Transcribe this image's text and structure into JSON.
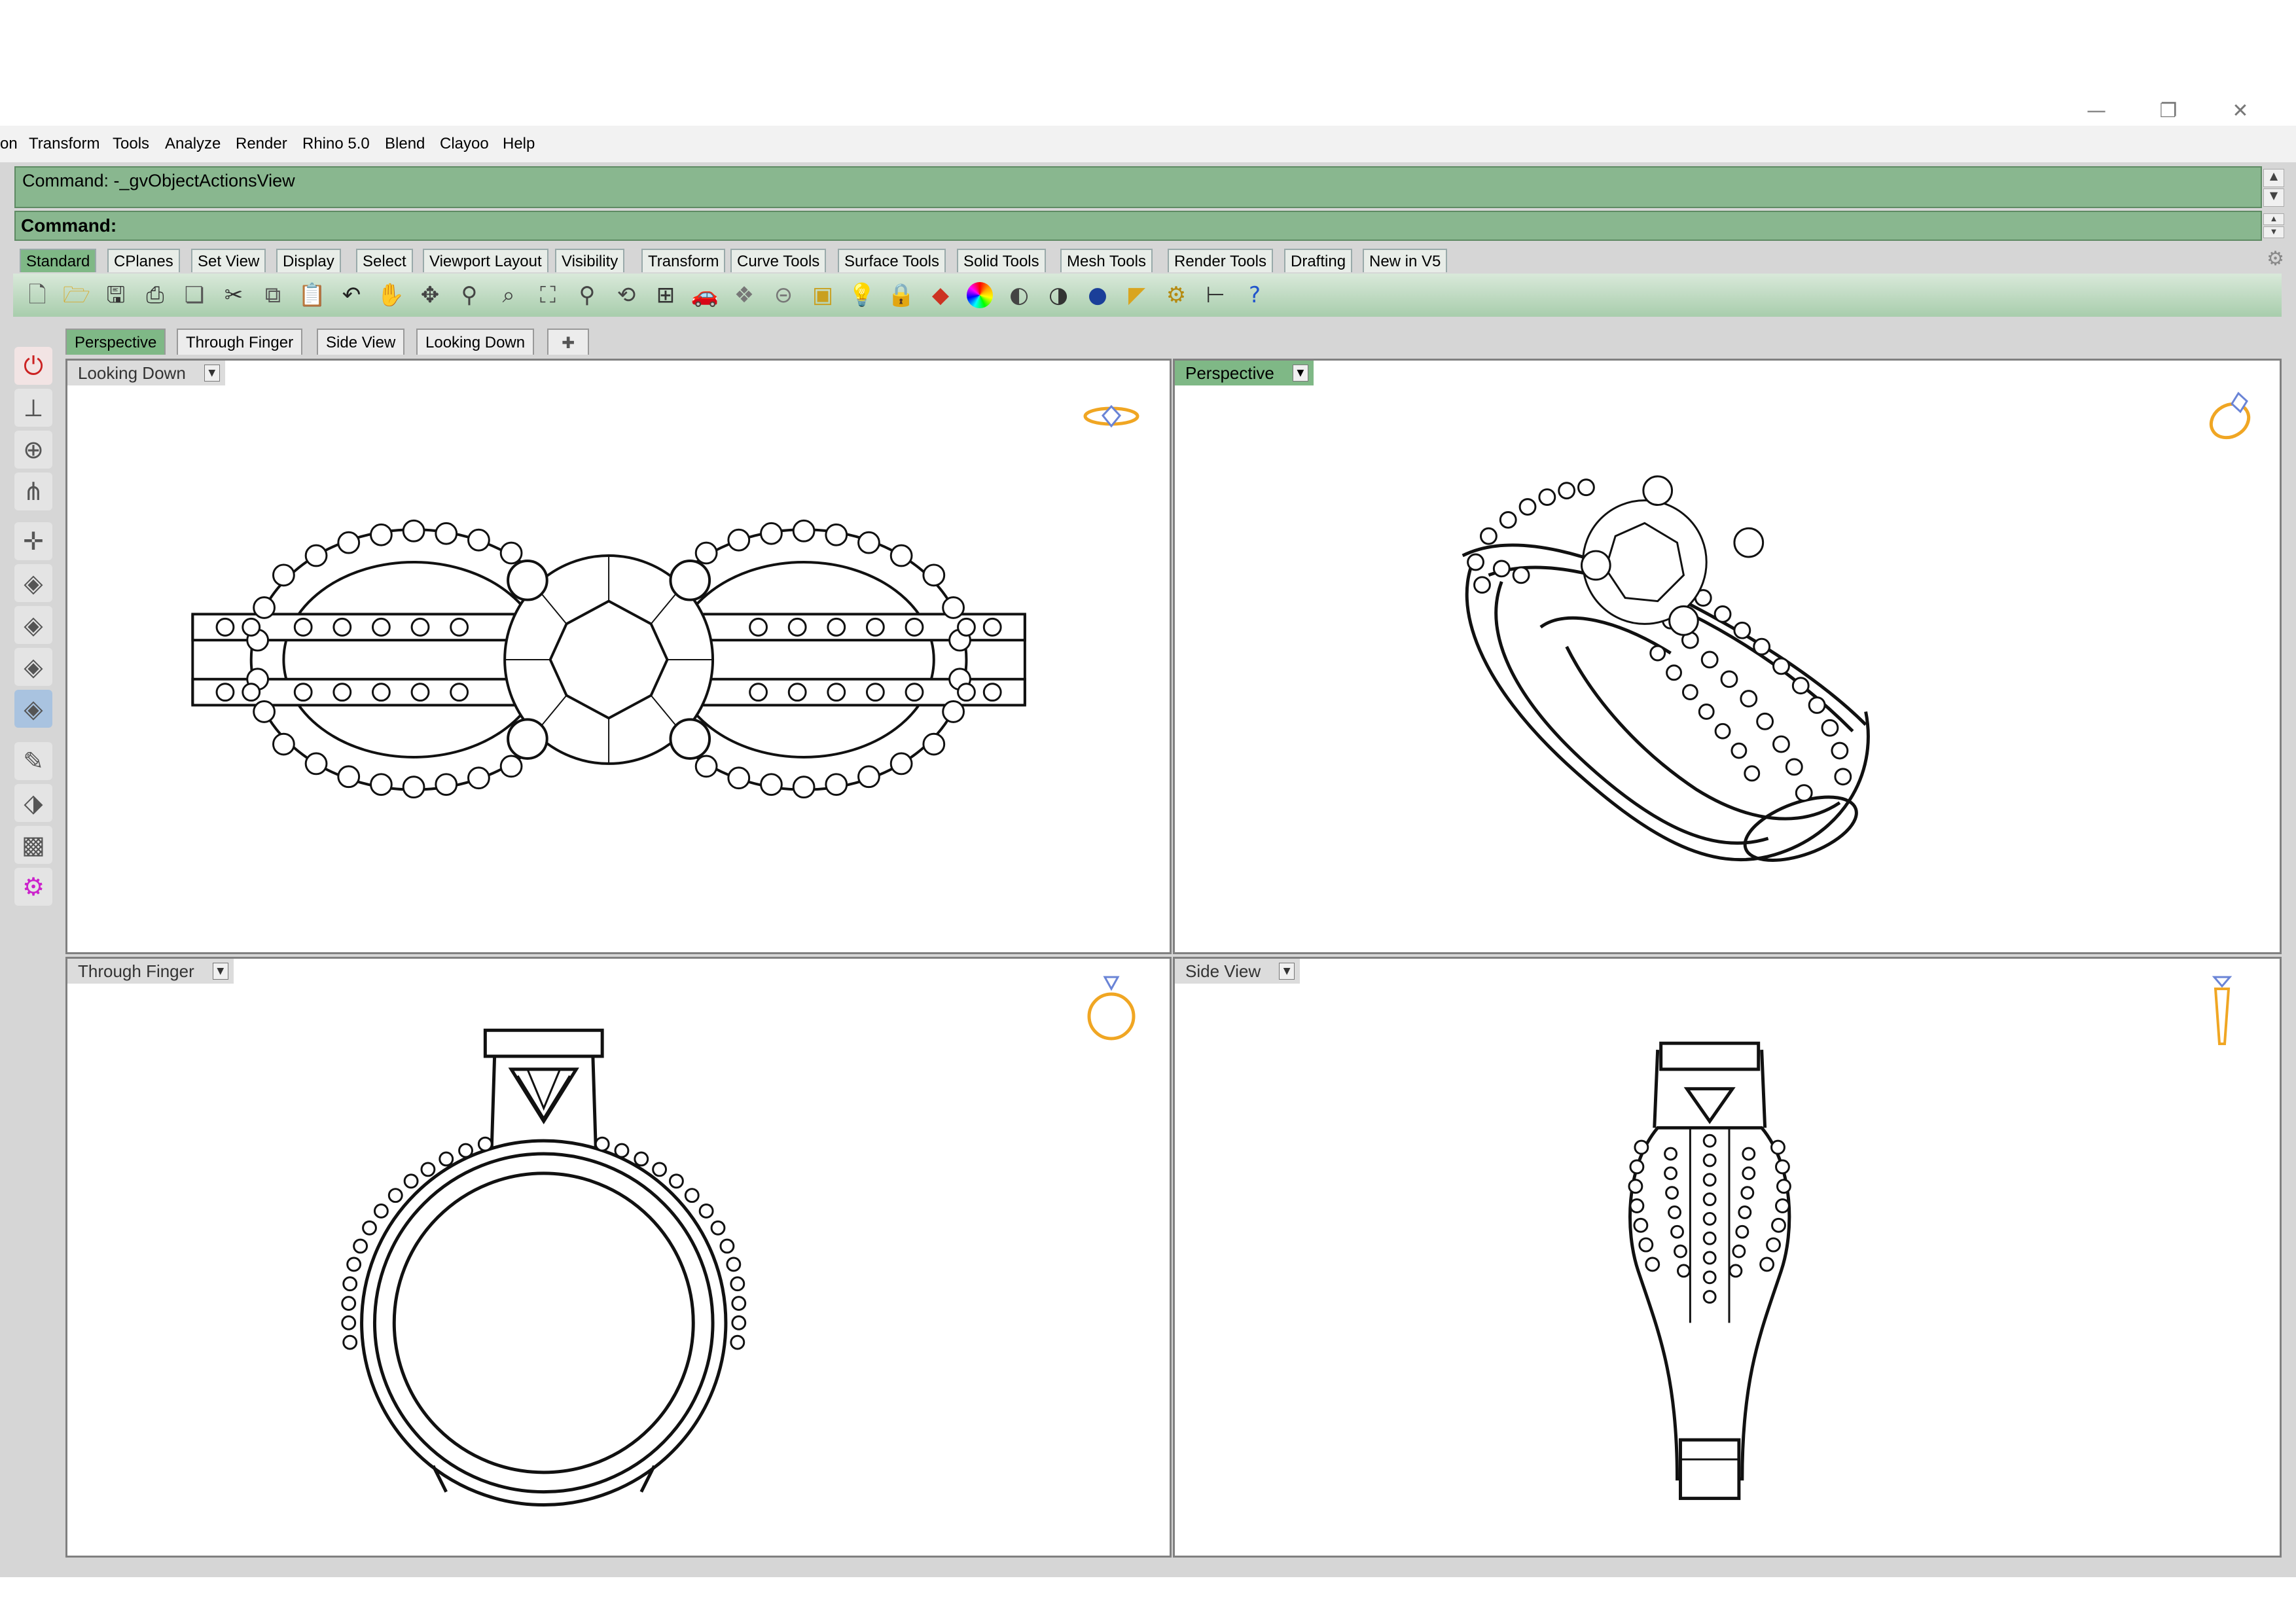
{
  "window": {
    "minimize": "—",
    "restore": "❐",
    "close": "✕"
  },
  "menu": [
    "on",
    "Transform",
    "Tools",
    "Analyze",
    "Render",
    "Rhino 5.0",
    "Blend",
    "Clayoo",
    "Help"
  ],
  "command": {
    "history": "Command: -_gvObjectActionsView",
    "prompt": "Command:"
  },
  "toolbar_tabs": [
    "Standard",
    "CPlanes",
    "Set View",
    "Display",
    "Select",
    "Viewport Layout",
    "Visibility",
    "Transform",
    "Curve Tools",
    "Surface Tools",
    "Solid Tools",
    "Mesh Tools",
    "Render Tools",
    "Drafting",
    "New in V5"
  ],
  "active_toolbar_tab": "Standard",
  "toolbar_icons": [
    "new-icon",
    "open-icon",
    "save-icon",
    "print-icon",
    "template-icon",
    "cut-icon",
    "copy-icon",
    "paste-icon",
    "undo-icon",
    "pan-hand-icon",
    "move-view-icon",
    "zoom-icon",
    "zoom-window-icon",
    "zoom-extents-icon",
    "zoom-selected-icon",
    "rotate-view-icon",
    "four-viewports-icon",
    "car-render-icon",
    "named-views-icon",
    "hide-icon",
    "show-icon",
    "light-icon",
    "lock-icon",
    "layer-icon",
    "color-wheel-icon",
    "shaded-sphere-icon",
    "rendered-sphere-icon",
    "render-sphere-icon",
    "properties-icon",
    "options-gear-icon",
    "dimension-icon",
    "help-icon"
  ],
  "viewport_tabs": [
    "Perspective",
    "Through Finger",
    "Side View",
    "Looking Down"
  ],
  "viewport_tab_add": "✚",
  "left_tools": [
    "stop-icon",
    "gumball-icon",
    "orbit-icon",
    "cplane-icon",
    "axes-icon",
    "box-view-1-icon",
    "box-view-2-icon",
    "box-view-3-icon",
    "box-view-4-icon",
    "paint-icon",
    "texture-icon",
    "surface-icon",
    "gear-plugin-icon"
  ],
  "viewports": {
    "top_left": {
      "label": "Looking Down",
      "active": false
    },
    "top_right": {
      "label": "Perspective",
      "active": true
    },
    "bottom_left": {
      "label": "Through Finger",
      "active": false
    },
    "bottom_right": {
      "label": "Side View",
      "active": false
    }
  },
  "colors": {
    "accent_green": "#7fb886",
    "command_green": "#89b78f",
    "ring_gold": "#f0a623",
    "gem_blue": "#6a84d6"
  }
}
